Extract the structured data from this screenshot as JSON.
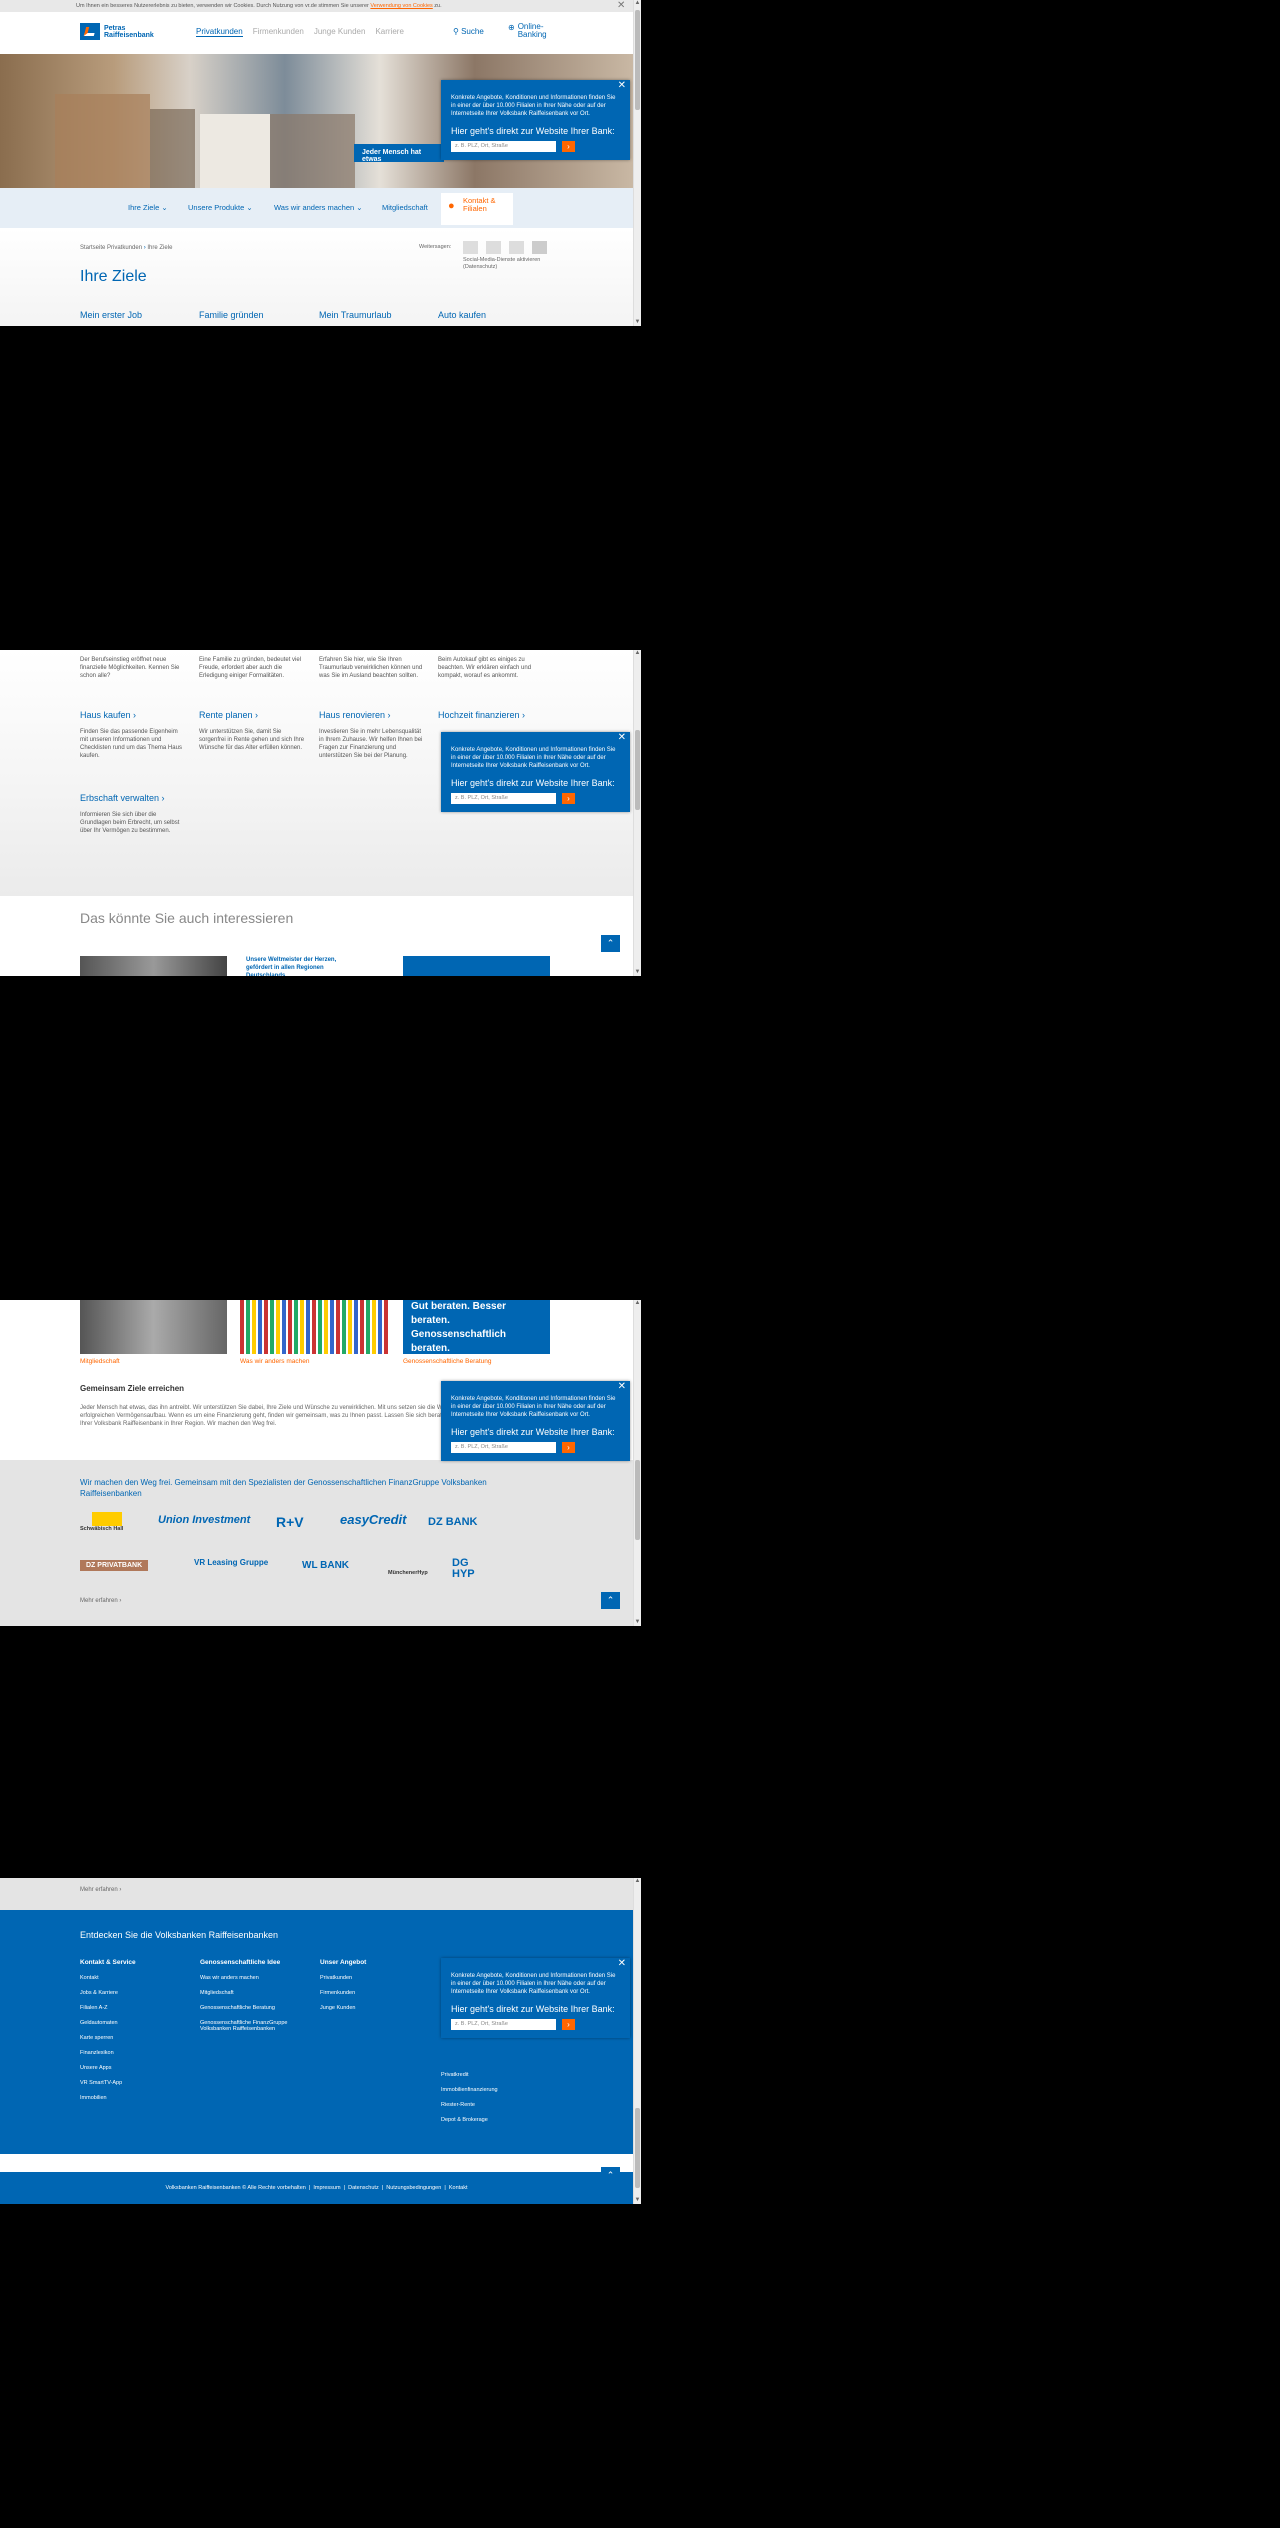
{
  "cookie": {
    "text": "Um Ihnen ein besseres Nutzererlebnis zu bieten, verwenden wir Cookies. Durch Nutzung von vr.de stimmen Sie unserer",
    "link": "Verwendung von Cookies",
    "end": " zu."
  },
  "brand": {
    "line1": "Petras",
    "line2": "Raiffeisenbank"
  },
  "topnav": [
    "Privatkunden",
    "Firmenkunden",
    "Junge Kunden",
    "Karriere"
  ],
  "search": "Suche",
  "banking": {
    "l1": "Online-",
    "l2": "Banking"
  },
  "hero": {
    "caption": "Jeder Mensch hat etwas"
  },
  "mainnav": [
    "Ihre Ziele",
    "Unsere Produkte",
    "Was wir anders machen",
    "Mitgliedschaft"
  ],
  "contact": {
    "l1": "Kontakt &",
    "l2": "Filialen"
  },
  "breadcrumb": [
    "Startseite Privatkunden",
    "Ihre Ziele"
  ],
  "share": {
    "label": "Weitersagen:",
    "note": "Social-Media-Dienste aktivieren (Datenschutz)"
  },
  "page_title": "Ihre Ziele",
  "overlay": {
    "text": "Konkrete Angebote, Konditionen und Informationen finden Sie in einer der über 10.000 Filialen in Ihrer Nähe oder auf der Internetseite Ihrer Volksbank Raiffeisenbank vor Ort.",
    "head": "Hier geht's direkt zur Website Ihrer Bank:",
    "placeholder": "z. B. PLZ, Ort, Straße"
  },
  "goals_row1": [
    "Mein erster Job",
    "Familie gründen",
    "Mein Traumurlaub",
    "Auto kaufen"
  ],
  "goals_row1_desc": [
    "Der Berufseinstieg eröffnet neue finanzielle Möglichkeiten. Kennen Sie schon alle?",
    "Eine Familie zu gründen, bedeutet viel Freude, erfordert aber auch die Erledigung einiger Formalitäten.",
    "Erfahren Sie hier, wie Sie Ihren Traumurlaub verwirklichen können und was Sie im Ausland beachten sollten.",
    "Beim Autokauf gibt es einiges zu beachten. Wir erklären einfach und kompakt, worauf es ankommt."
  ],
  "goals_row2": [
    "Haus kaufen",
    "Rente planen",
    "Haus renovieren",
    "Hochzeit finanzieren"
  ],
  "goals_row2_desc": [
    "Finden Sie das passende Eigenheim mit unseren Informationen und Checklisten rund um das Thema Haus kaufen.",
    "Wir unterstützen Sie, damit Sie sorgenfrei in Rente gehen und sich Ihre Wünsche für das Alter erfüllen können.",
    "Investieren Sie in mehr Lebensqualität in Ihrem Zuhause. Wir helfen Ihnen bei Fragen zur Finanzierung und unterstützen Sie bei der Planung.",
    ""
  ],
  "goals_row3": [
    "Erbschaft verwalten"
  ],
  "goals_row3_desc": [
    "Informieren Sie sich über die Grundlagen beim Erbrecht, um selbst über Ihr Vermögen zu bestimmen."
  ],
  "interest": {
    "title": "Das könnte Sie auch interessieren",
    "teaser": "Unsere Weltmeister der Herzen, gefördert in allen Regionen Deutschlands",
    "tile": "Gut beraten. Besser beraten. Genossenschaftlich beraten.",
    "links": [
      "Mitgliedschaft",
      "Was wir anders machen",
      "Genossenschaftliche Beratung"
    ]
  },
  "together": {
    "title": "Gemeinsam Ziele erreichen",
    "text": "Jeder Mensch hat etwas, das ihn antreibt. Wir unterstützen Sie dabei, Ihre Ziele und Wünsche zu verwirklichen. Mit uns setzen sie die Weichen für Ihren erfolgreichen Vermögensaufbau. Wenn es um eine Finanzierung geht, finden wir gemeinsam, was zu Ihnen passt. Lassen Sie sich beraten in einer Filiale Ihrer Volksbank Raiffeisenbank in Ihrer Region. Wir machen den Weg frei."
  },
  "partners": {
    "title": "Wir machen den Weg frei. Gemeinsam mit den Spezialisten der Genossenschaftlichen FinanzGruppe Volksbanken Raiffeisenbanken",
    "logos": [
      "Schwäbisch Hall",
      "Union Investment",
      "R+V",
      "easyCredit",
      "DZ BANK",
      "DZ PRIVATBANK",
      "VR Leasing Gruppe",
      "WL BANK",
      "MünchenerHyp",
      "DG HYP"
    ],
    "more": "Mehr erfahren"
  },
  "footer": {
    "title": "Entdecken Sie die Volksbanken Raiffeisenbanken",
    "col1": {
      "head": "Kontakt & Service",
      "items": [
        "Kontakt",
        "Jobs & Karriere",
        "Filialen A-Z",
        "Geldautomaten",
        "Karte sperren",
        "Finanzlexikon",
        "Unsere Apps",
        "VR SmartTV-App",
        "Immobilien"
      ]
    },
    "col2": {
      "head": "Genossenschaftliche Idee",
      "items": [
        "Was wir anders machen",
        "Mitgliedschaft",
        "Genossenschaftliche Beratung",
        "Genossenschaftliche FinanzGruppe Volksbanken Raiffeisenbanken"
      ]
    },
    "col3": {
      "head": "Unser Angebot",
      "items": [
        "Privatkunden",
        "Firmenkunden",
        "Junge Kunden"
      ]
    },
    "col4": {
      "items": [
        "Privatkredit",
        "Immobilienfinanzierung",
        "Riester-Rente",
        "Depot & Brokerage"
      ]
    },
    "legal": [
      "Volksbanken Raiffeisenbanken © Alle Rechte vorbehalten",
      "Impressum",
      "Datenschutz",
      "Nutzungsbedingungen",
      "Kontakt"
    ]
  },
  "colors": {
    "brand": "#0066b3",
    "accent": "#ff6600"
  }
}
